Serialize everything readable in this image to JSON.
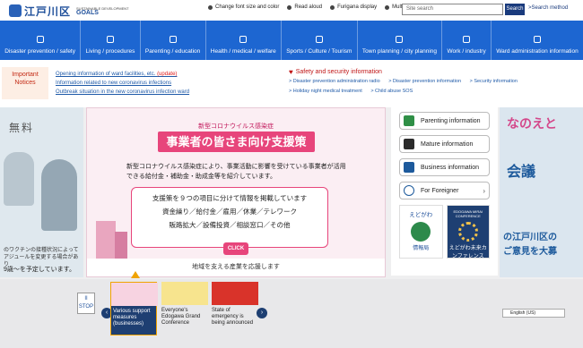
{
  "header": {
    "logo_name": "江戸川区",
    "logo_sdg": "SUSTAINABLE DEVELOPMENT",
    "logo_goals": "GOALS",
    "tools": [
      "Change font size and color",
      "Read aloud",
      "Furigana display",
      "Multilingual"
    ],
    "search_placeholder": "Site search",
    "search_button": "Search",
    "search_method": ">Search method"
  },
  "nav": [
    "Disaster prevention / safety",
    "Living / procedures",
    "Parenting / education",
    "Health / medical / welfare",
    "Sports / Culture / Tourism",
    "Town planning / city planning",
    "Work / industry",
    "Ward administration information"
  ],
  "notices": {
    "important_label": "Important Notices",
    "links": [
      {
        "text": "Opening information of ward facilities, etc. ",
        "tag": "(update)"
      },
      {
        "text": "Information related to new coronavirus infections",
        "tag": ""
      },
      {
        "text": "Outbreak situation in the new coronavirus infection ward",
        "tag": ""
      }
    ],
    "safety_title": "Safety and security information",
    "safety_links": [
      "> Disaster prevention administration radio",
      "> Disaster prevention information",
      "> Security information",
      "> Holiday night medical treatment",
      "> Child abuse SOS"
    ]
  },
  "hero": {
    "left": {
      "free": "無料",
      "text": "のワクチンの接種状況によって\nアジュールを変更する場合があり",
      "text2": "9歳〜を予定しています。"
    },
    "banner": {
      "subtitle": "新型コロナウイルス感染症",
      "title": "事業者の皆さま向け支援策",
      "desc": "新型コロナウイルス感染症により、事業活動に影響を受けている事業者が活用できる給付金・補助金・助成金等を紹介しています。",
      "box_heading": "支援策を９つの項目に分けて情報を掲載しています",
      "box_line1": "資金繰り／給付金／雇用／休業／テレワーク",
      "box_line2": "販路拡大／設備投資／相談窓口／その他",
      "click": "CLICK",
      "bottom": "地域を支える産業を応援します"
    },
    "quick": {
      "items": [
        "Parenting information",
        "Mature information",
        "Business information",
        "For Foreigner"
      ],
      "tile1_label": "えどがわ",
      "tile1_sub": "情報局",
      "tile2_label": "EDOGAWA MIRAI CONFERENCE",
      "tile2_sub": "えどがわ未来カンファレンス"
    },
    "right": {
      "r1": "なのえと",
      "r2": "会議",
      "r3": "の江戸川区の\nご意見を大募"
    }
  },
  "carousel": {
    "stop": "STOP",
    "slides": [
      "Various support measures (businesses)",
      "Everyone's Edogawa Grand Conference",
      "State of emergency is being announced"
    ],
    "lang": "English (US)"
  }
}
